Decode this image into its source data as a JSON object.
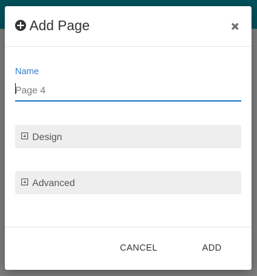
{
  "dialog": {
    "title": "Add Page",
    "title_icon": "plus-circle-icon",
    "close_icon": "close-icon"
  },
  "form": {
    "name_label": "Name",
    "name_placeholder": "Page 4",
    "name_value": ""
  },
  "sections": [
    {
      "label": "Design",
      "icon": "expand-plus-icon"
    },
    {
      "label": "Advanced",
      "icon": "expand-plus-icon"
    }
  ],
  "footer": {
    "cancel_label": "CANCEL",
    "add_label": "ADD"
  },
  "colors": {
    "accent": "#2f7fcf",
    "app_bar": "#00515c",
    "section_bg": "#eeeeee"
  }
}
